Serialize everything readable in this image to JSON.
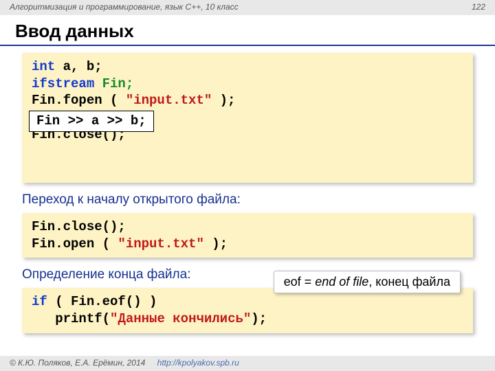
{
  "header": {
    "breadcrumb": "Алгоритмизация и программирование, язык C++, 10 класс",
    "page_number": "122"
  },
  "title": "Ввод данных",
  "code1": {
    "kw_int": "int",
    "vars": " a, b;",
    "kw_ifstream": "ifstream",
    "fin_decl": " Fin;",
    "fopen_call": "Fin.fopen ( ",
    "fopen_arg": "\"input.txt\"",
    "fopen_end": " );",
    "close_call": "Fin.close();",
    "inset": "Fin >> a >> b;"
  },
  "sub1": "Переход к началу открытого файла:",
  "code2": {
    "close": "Fin.close();",
    "open_call": "Fin.open ( ",
    "open_arg": "\"input.txt\"",
    "open_end": " );"
  },
  "sub2": "Определение конца файла:",
  "code3": {
    "kw_if": "if",
    "cond": " ( Fin.eof() )",
    "indent": "   ",
    "printf_call": "printf(",
    "printf_arg": "\"Данные кончились\"",
    "printf_end": ");"
  },
  "tooltip": {
    "prefix": "eof = ",
    "italic": "end of file",
    "suffix": ", конец файла"
  },
  "footer": {
    "copy": "© К.Ю. Поляков, Е.А. Ерёмин, 2014",
    "url": "http://kpolyakov.spb.ru"
  }
}
